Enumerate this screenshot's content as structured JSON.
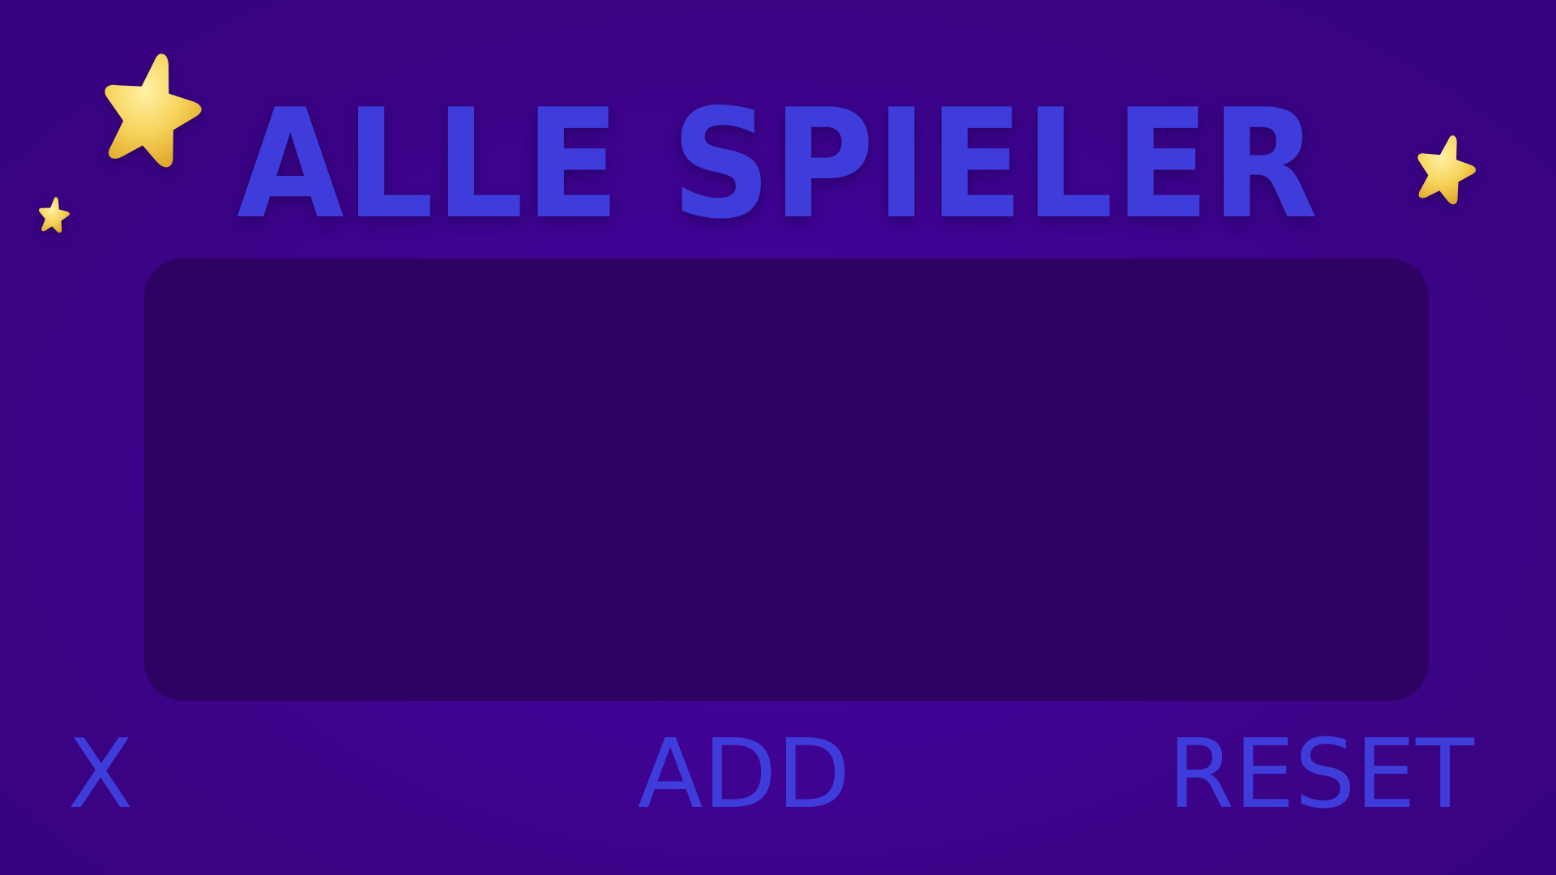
{
  "screen": {
    "title": "ALLE SPIELER"
  },
  "player_list": {
    "players": []
  },
  "buttons": {
    "close_label": "X",
    "add_label": "ADD",
    "reset_label": "RESET"
  },
  "decorations": {
    "icons": [
      "star-icon"
    ],
    "star_color": "#f7d35a"
  },
  "colors": {
    "background": "#3f0394",
    "panel": "#2e0262",
    "accent": "#3e3ddc"
  }
}
